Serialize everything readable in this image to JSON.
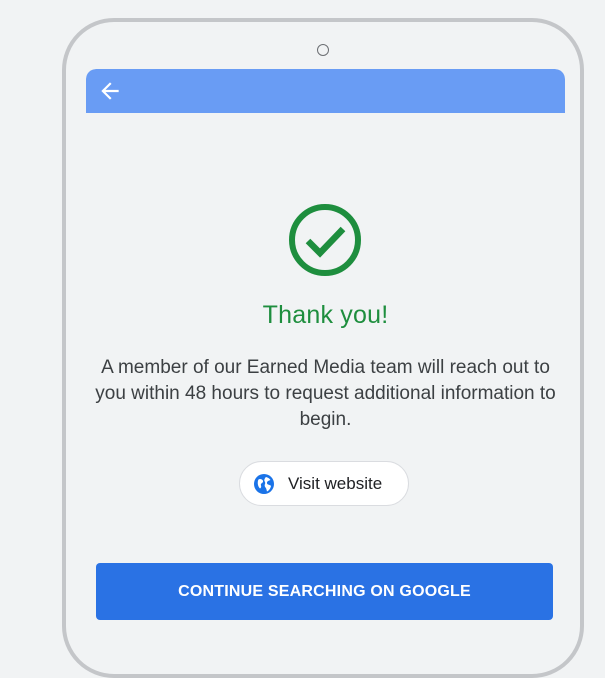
{
  "header": {
    "back_icon": "arrow-left-icon",
    "bar_color": "#699cf4"
  },
  "confirmation": {
    "icon": "check-circle-icon",
    "icon_color": "#1e8e3e",
    "title": "Thank you!",
    "message": "A member of our Earned Media team will reach out to you within 48 hours to request additional information to begin."
  },
  "visit_website": {
    "icon": "globe-icon",
    "label": "Visit website"
  },
  "footer": {
    "continue_label": "CONTINUE SEARCHING ON GOOGLE",
    "continue_color": "#2a72e4"
  }
}
